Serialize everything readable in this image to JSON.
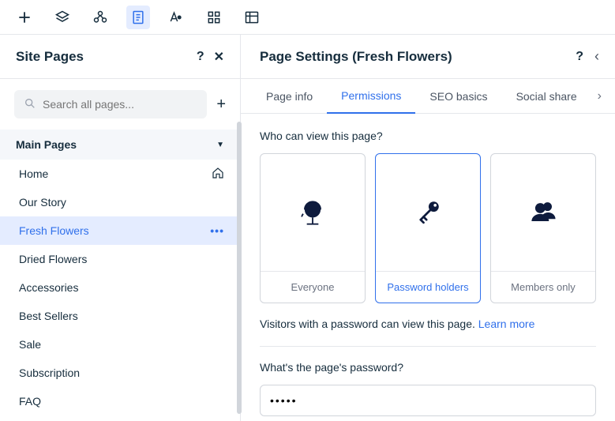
{
  "toolbar": {
    "tools": [
      "plus",
      "layers",
      "components",
      "page",
      "design",
      "apps",
      "data"
    ]
  },
  "sidebar": {
    "title": "Site Pages",
    "search_placeholder": "Search all pages...",
    "section_title": "Main Pages",
    "pages": [
      {
        "label": "Home",
        "icon": "home",
        "selected": false
      },
      {
        "label": "Our Story",
        "selected": false
      },
      {
        "label": "Fresh Flowers",
        "selected": true,
        "more": true
      },
      {
        "label": "Dried Flowers",
        "selected": false
      },
      {
        "label": "Accessories",
        "selected": false
      },
      {
        "label": "Best Sellers",
        "selected": false
      },
      {
        "label": "Sale",
        "selected": false
      },
      {
        "label": "Subscription",
        "selected": false
      },
      {
        "label": "FAQ",
        "selected": false
      }
    ]
  },
  "settings": {
    "title": "Page Settings (Fresh Flowers)",
    "tabs": [
      {
        "label": "Page info",
        "active": false
      },
      {
        "label": "Permissions",
        "active": true
      },
      {
        "label": "SEO basics",
        "active": false
      },
      {
        "label": "Social share",
        "active": false
      }
    ],
    "view_question": "Who can view this page?",
    "options": [
      {
        "label": "Everyone",
        "icon": "globe",
        "selected": false
      },
      {
        "label": "Password holders",
        "icon": "key",
        "selected": true
      },
      {
        "label": "Members only",
        "icon": "members",
        "selected": false
      }
    ],
    "info_text": "Visitors with a password can view this page. ",
    "learn_more": "Learn more",
    "password_question": "What's the page's password?",
    "password_value": "•••••"
  }
}
